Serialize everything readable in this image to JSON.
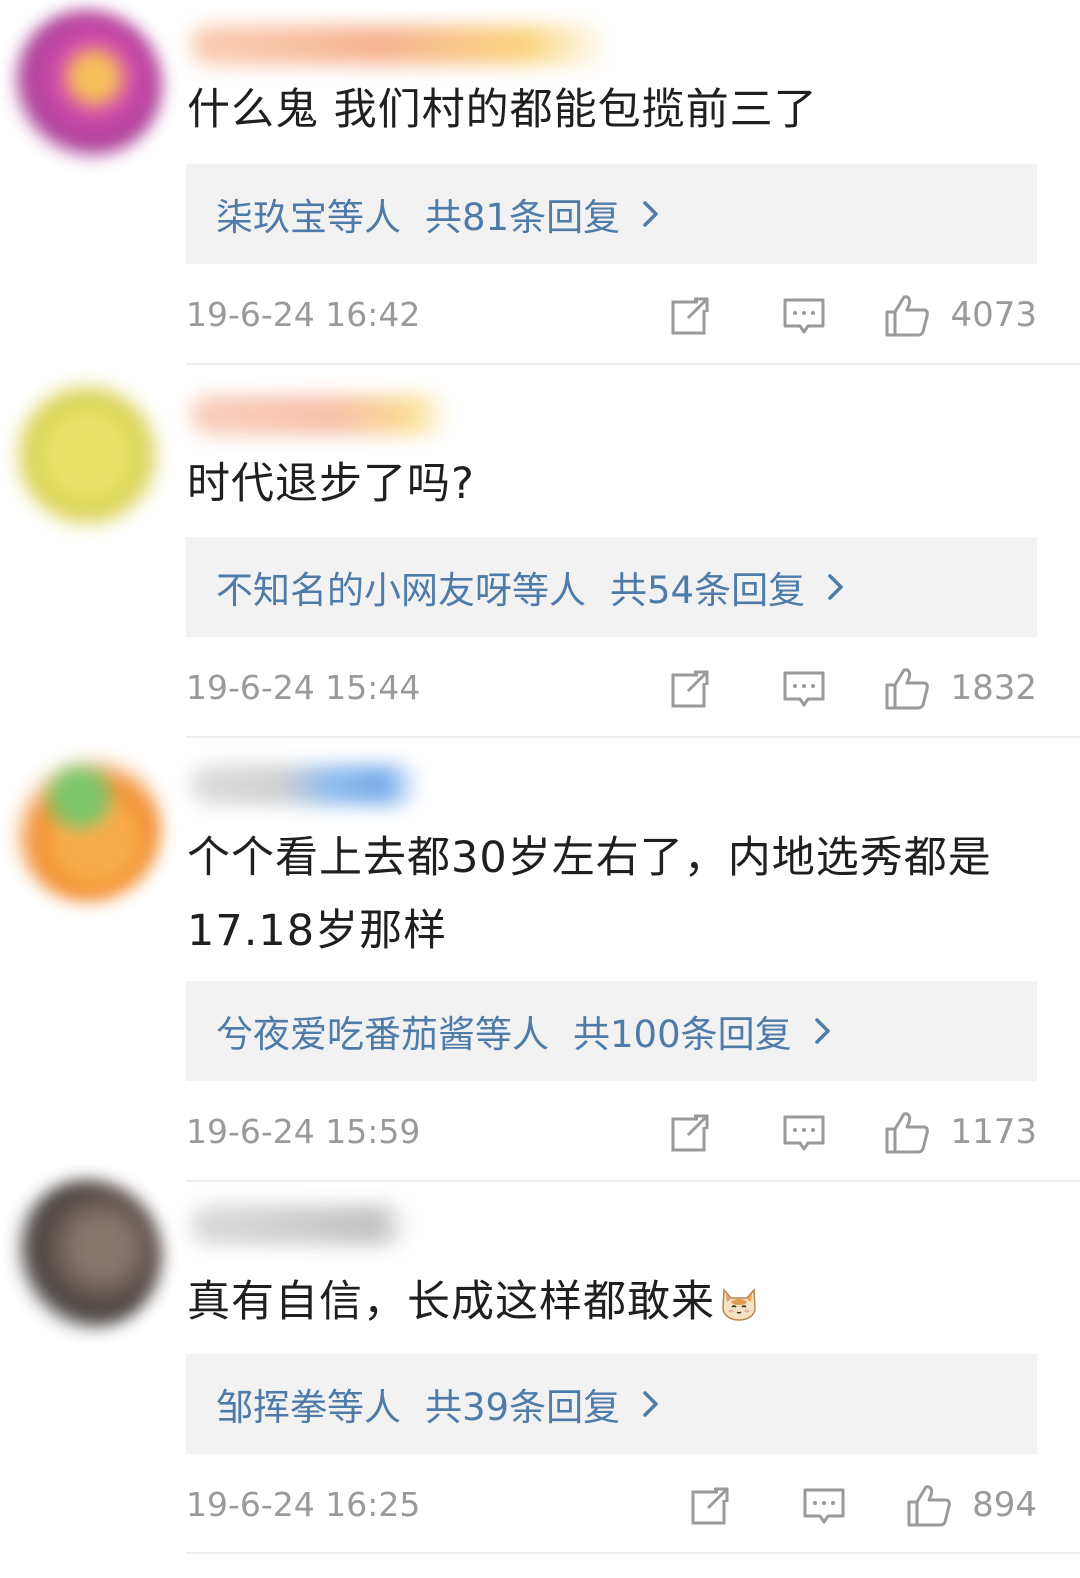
{
  "comments": [
    {
      "text": "什么鬼  我们村的都能包揽前三了",
      "reply_users": "柒玖宝等人",
      "reply_count": "共81条回复",
      "time": "19-6-24 16:42",
      "likes": "4073",
      "avatar_color": "#c23aa0",
      "name_colors": [
        "#f6b08a",
        "#f8c23c"
      ]
    },
    {
      "text": "时代退步了吗?",
      "reply_users": "不知名的小网友呀等人",
      "reply_count": "共54条回复",
      "time": "19-6-24 15:44",
      "likes": "1832",
      "avatar_color": "#d8d24a",
      "name_colors": [
        "#f6b59a",
        "#f7d27a"
      ]
    },
    {
      "text_line1": "个个看上去都30岁左右了，内地选秀都是",
      "text_line2": "17.18岁那样",
      "reply_users": "兮夜爱吃番茄酱等人",
      "reply_count": "共100条回复",
      "time": "19-6-24 15:59",
      "likes": "1173",
      "avatar_color": "#f38a1c",
      "name_colors": [
        "#cfcfcf",
        "#6fa8e8"
      ]
    },
    {
      "text": "真有自信，长成这样都敢来",
      "reply_users": "邹挥拳等人",
      "reply_count": "共39条回复",
      "time": "19-6-24 16:25",
      "likes": "894",
      "avatar_color": "#5a4a44",
      "name_colors": [
        "#cfcfcf",
        "#bdbdbd"
      ]
    }
  ],
  "icons": {
    "share": "share-icon",
    "comment": "comment-icon",
    "like": "thumbs-up-icon",
    "chevron": "chevron-right-icon",
    "emoji": "cat-emoji-icon"
  },
  "colors": {
    "reply_link": "#4f7ba9",
    "reply_bg": "#f2f2f2",
    "meta_gray": "#9a9a9a",
    "text": "#1f1f1f"
  }
}
